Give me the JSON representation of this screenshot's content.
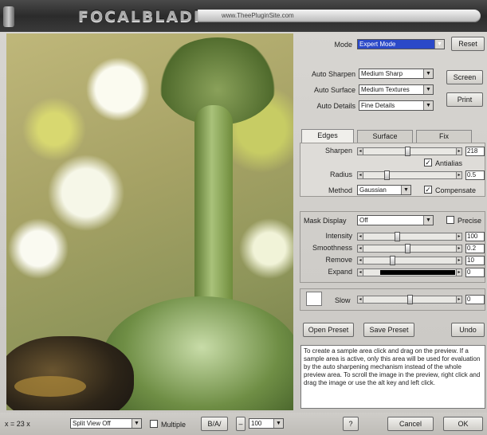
{
  "app": {
    "title": "FOCALBLADE",
    "url": "www.TheePluginSite.com"
  },
  "mode": {
    "label": "Mode",
    "value": "Expert Mode"
  },
  "buttons": {
    "reset": "Reset",
    "screen": "Screen",
    "print": "Print",
    "open_preset": "Open Preset",
    "save_preset": "Save Preset",
    "undo": "Undo",
    "help": "?",
    "cancel": "Cancel",
    "ok": "OK"
  },
  "auto": {
    "sharpen": {
      "label": "Auto Sharpen",
      "value": "Medium Sharp"
    },
    "surface": {
      "label": "Auto Surface",
      "value": "Medium Textures"
    },
    "details": {
      "label": "Auto Details",
      "value": "Fine Details"
    }
  },
  "tabs": [
    "Edges",
    "Surface",
    "Fix"
  ],
  "edges": {
    "sharpen": {
      "label": "Sharpen",
      "value": "218",
      "level": 0.45
    },
    "antialias": {
      "label": "Antialias",
      "checked": true
    },
    "radius": {
      "label": "Radius",
      "value": "0.5",
      "level": 0.25
    },
    "method": {
      "label": "Method",
      "value": "Gaussian"
    },
    "compensate": {
      "label": "Compensate",
      "checked": true
    }
  },
  "mask": {
    "display_label": "Mask Display",
    "display_value": "Off",
    "precise_label": "Precise",
    "intensity": {
      "label": "Intensity",
      "value": "100",
      "level": 0.35
    },
    "smoothness": {
      "label": "Smoothness",
      "value": "0.2",
      "level": 0.45
    },
    "remove": {
      "label": "Remove",
      "value": "10",
      "level": 0.3
    },
    "expand": {
      "label": "Expand",
      "value": "0",
      "level": 0.15
    }
  },
  "slow": {
    "label": "Slow",
    "value": "0",
    "level": 0.5
  },
  "help_text": "To create a sample area click and drag on the preview. If a sample area is active, only this area will be used for evaluation by the auto sharpening mechanism instead of the whole preview area. To scroll the image in the preview, right click and drag the image or use the alt key and left click.",
  "status": {
    "zoom_text": "x = 23 x",
    "split_view": "Split View Off",
    "multiple_label": "Multiple",
    "ba_label": "B/A/",
    "zoom_value": "100"
  },
  "colors": {
    "titlebar": "#2b2b2b",
    "panel": "#d0cec9",
    "mode_highlight": "#2b49c8",
    "expand_bar": "#000000"
  }
}
